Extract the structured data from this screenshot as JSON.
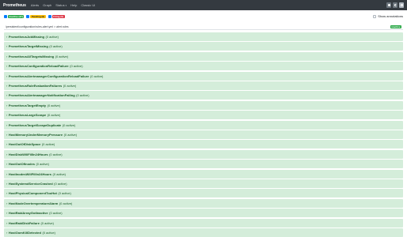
{
  "nav": {
    "brand": "Prometheus",
    "links": [
      "Alerts",
      "Graph",
      "Status",
      "Help",
      "Classic UI"
    ]
  },
  "filters": {
    "inactive": "Inactive (47)",
    "pending": "Pending (0)",
    "firing": "Firing (0)",
    "show_annotations": "Show annotations"
  },
  "group": {
    "path": "/persistent/configuration/rules-alert.yml > alert.rules",
    "badge": "inactive"
  },
  "alerts": [
    {
      "name": "PrometheusJobMissing",
      "count": "(0 active)"
    },
    {
      "name": "PrometheusTargetMissing",
      "count": "(0 active)"
    },
    {
      "name": "PrometheusAllTargetsMissing",
      "count": "(0 active)"
    },
    {
      "name": "PrometheusConfigurationReloadFailure",
      "count": "(0 active)"
    },
    {
      "name": "PrometheusAlertmanagerConfigurationReloadFailure",
      "count": "(0 active)"
    },
    {
      "name": "PrometheusRuleEvaluationFailures",
      "count": "(0 active)"
    },
    {
      "name": "PrometheusAlertmanagerNotificationFailing",
      "count": "(0 active)"
    },
    {
      "name": "PrometheusTargetEmpty",
      "count": "(0 active)"
    },
    {
      "name": "PrometheusLargeScrape",
      "count": "(0 active)"
    },
    {
      "name": "PrometheusTargetScrapeDuplicate",
      "count": "(0 active)"
    },
    {
      "name": "HostMemoryUnderMemoryPressure",
      "count": "(0 active)"
    },
    {
      "name": "HostOutOfDiskSpace",
      "count": "(0 active)"
    },
    {
      "name": "HostDiskWillFillIn24Hours",
      "count": "(0 active)"
    },
    {
      "name": "HostOutOfInodes",
      "count": "(0 active)"
    },
    {
      "name": "HostInodesWillFillIn24Hours",
      "count": "(0 active)"
    },
    {
      "name": "HostSystemdServiceCrashed",
      "count": "(0 active)"
    },
    {
      "name": "HostPhysicalComponentTooHot",
      "count": "(0 active)"
    },
    {
      "name": "HostNodeOvertemperatureAlarm",
      "count": "(0 active)"
    },
    {
      "name": "HostRaidArrayGotInactive",
      "count": "(0 active)"
    },
    {
      "name": "HostRaidDiskFailure",
      "count": "(0 active)"
    },
    {
      "name": "HostOomKillDetected",
      "count": "(0 active)"
    }
  ]
}
